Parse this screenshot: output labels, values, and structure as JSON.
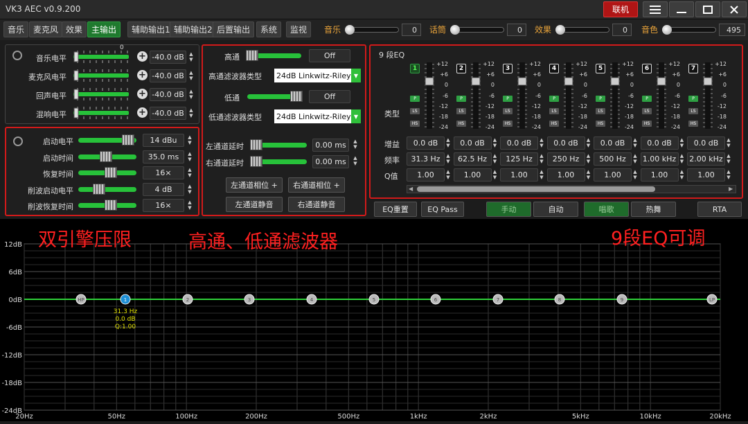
{
  "window": {
    "title": "VK3 AEC v0.9.200",
    "connect_label": "联机",
    "menu_icon": "menu-icon",
    "minimize_icon": "minimize-icon",
    "maximize_icon": "maximize-icon",
    "close_icon": "close-icon"
  },
  "tabs": [
    "音乐",
    "麦克风",
    "效果",
    "主输出",
    "辅助输出1",
    "辅助输出2",
    "后置输出",
    "系统",
    "监视"
  ],
  "active_tab": "主输出",
  "mixer": [
    {
      "label": "音乐",
      "value": "0"
    },
    {
      "label": "话筒",
      "value": "0"
    },
    {
      "label": "效果",
      "value": "0"
    },
    {
      "label": "音色",
      "value": "495"
    }
  ],
  "levels": {
    "fader_zero": "0",
    "rows": [
      {
        "label": "音乐电平",
        "value": "-40.0 dB"
      },
      {
        "label": "麦克风电平",
        "value": "-40.0 dB"
      },
      {
        "label": "回声电平",
        "value": "-40.0 dB"
      },
      {
        "label": "混响电平",
        "value": "-40.0 dB"
      }
    ]
  },
  "limiter": {
    "rows": [
      {
        "label": "启动电平",
        "value": "14 dBu"
      },
      {
        "label": "启动时间",
        "value": "35.0 ms"
      },
      {
        "label": "恢复时间",
        "value": "16×"
      },
      {
        "label": "削波启动电平",
        "value": "4 dB"
      },
      {
        "label": "削波恢复时间",
        "value": "16×"
      }
    ]
  },
  "filters": {
    "highpass_label": "高通",
    "highpass_value": "Off",
    "hp_type_label": "高通滤波器类型",
    "hp_type_value": "24dB Linkwitz-Riley",
    "lowpass_label": "低通",
    "lowpass_value": "Off",
    "lp_type_label": "低通滤波器类型",
    "lp_type_value": "24dB Linkwitz-Riley",
    "left_delay_label": "左通道延时",
    "left_delay_value": "0.00 ms",
    "right_delay_label": "右通道延时",
    "right_delay_value": "0.00 ms",
    "left_phase": "左通道相位 +",
    "right_phase": "右通道相位 +",
    "left_mute": "左通道静音",
    "right_mute": "右通道静音"
  },
  "eq": {
    "title": "9 段EQ",
    "type_label": "类型",
    "scale": [
      "+12",
      "+6",
      "0",
      "-6",
      "-12",
      "-18",
      "-24"
    ],
    "bands": [
      "1",
      "2",
      "3",
      "4",
      "5",
      "6",
      "7"
    ],
    "gain_label": "增益",
    "freq_label": "频率",
    "q_label": "Q值",
    "gains": [
      "0.0 dB",
      "0.0 dB",
      "0.0 dB",
      "0.0 dB",
      "0.0 dB",
      "0.0 dB",
      "0.0 dB"
    ],
    "freqs": [
      "31.3 Hz",
      "62.5 Hz",
      "125 Hz",
      "250 Hz",
      "500 Hz",
      "1.00 kHz",
      "2.00 kHz"
    ],
    "qs": [
      "1.00",
      "1.00",
      "1.00",
      "1.00",
      "1.00",
      "1.00",
      "1.00"
    ],
    "type_buttons": [
      "P",
      "LS",
      "HS"
    ]
  },
  "bottom_buttons": {
    "eq_reset": "EQ重置",
    "eq_pass": "EQ Pass",
    "manual": "手动",
    "auto": "自动",
    "sing": "唱歌",
    "dance": "热舞",
    "rta": "RTA"
  },
  "annotations": {
    "left": "双引擎压限",
    "middle": "高通、低通滤波器",
    "right": "9段EQ可调"
  },
  "graph": {
    "y_labels": [
      "12dB",
      "6dB",
      "0dB",
      "-6dB",
      "-12dB",
      "-18dB",
      "-24dB"
    ],
    "x_labels": [
      "20Hz",
      "50Hz",
      "100Hz",
      "200Hz",
      "500Hz",
      "1kHz",
      "2kHz",
      "5kHz",
      "10kHz",
      "20kHz"
    ],
    "nodes": [
      "HP",
      "1",
      "2",
      "3",
      "4",
      "5",
      "6",
      "7",
      "8",
      "9",
      "LP"
    ],
    "selected_info": [
      "31.3 Hz",
      "0.0 dB",
      "Q:1.00"
    ],
    "colors": {
      "curve": "#2fd23a",
      "selected": "#1d8fd6",
      "info": "#e0e000"
    }
  }
}
